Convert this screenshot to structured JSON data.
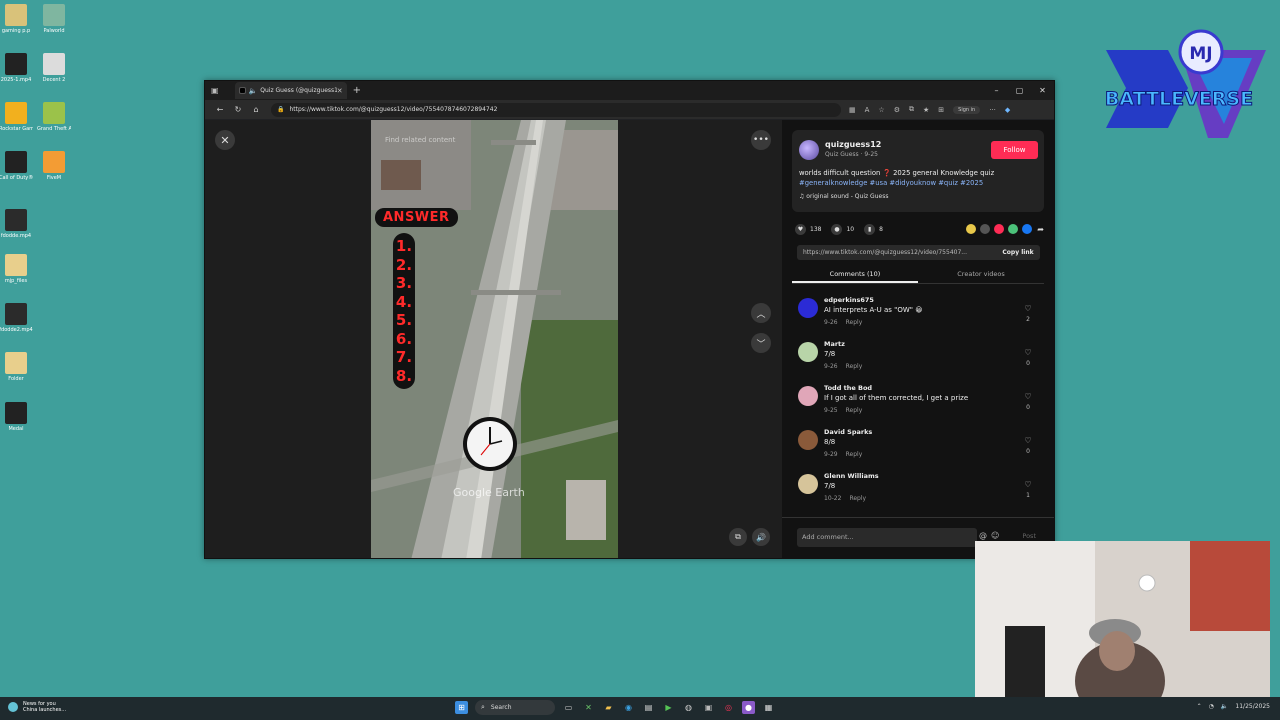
{
  "desktop": {
    "icons": [
      {
        "label": "gaming p.p",
        "color": "#d9c27a"
      },
      {
        "label": "Palworld",
        "color": "#7fb6a0"
      },
      {
        "label": "2025-1.mp4",
        "color": "#222222"
      },
      {
        "label": "Decent 2",
        "color": "#dcdcdc"
      },
      {
        "label": "Rockstar Games ...",
        "color": "#f2b01e"
      },
      {
        "label": "Grand Theft Auto V Le...",
        "color": "#9bc24a"
      },
      {
        "label": "Call of Duty®",
        "color": "#222222"
      },
      {
        "label": "FiveM",
        "color": "#f39c34"
      },
      {
        "label": "fdodde.mp4",
        "color": "#2b2b2b"
      },
      {
        "label": "mjp_files",
        "color": "#e8cf8c"
      },
      {
        "label": "fdodde2.mp4",
        "color": "#2b2b2b"
      },
      {
        "label": "Folder",
        "color": "#e8cf8c"
      },
      {
        "label": "Medal",
        "color": "#222222"
      }
    ]
  },
  "overlay_logo": {
    "text": "BATTLEVERSE",
    "monogram": "MJ",
    "badge": "DV"
  },
  "browser": {
    "tab_title": "Quiz Guess (@quizguess12)",
    "new_tab": "+",
    "url": "https://www.tiktok.com/@quizguess12/video/7554078746072894742",
    "sign_in": "Sign in",
    "window_controls": [
      "–",
      "▢",
      "✕"
    ]
  },
  "video": {
    "answer_label": "ANSWER",
    "numbers": [
      "1.",
      "2.",
      "3.",
      "4.",
      "5.",
      "6.",
      "7.",
      "8."
    ],
    "hint": "Find related content",
    "watermark": "Google Earth"
  },
  "creator": {
    "username": "quizguess12",
    "subline": "Quiz Guess · 9-25",
    "follow_label": "Follow",
    "description": "worlds difficult question ❓ 2025 general Knowledge quiz",
    "hashtags": "#generalknowledge #usa #didyouknow #quiz #2025",
    "sound": "♫  original sound - Quiz Guess"
  },
  "stats": {
    "likes": "138",
    "comments": "10",
    "saves": "8",
    "share_colors": [
      "#e8c84a",
      "#555555",
      "#fe2c55",
      "#4cc27a",
      "#1877f2"
    ]
  },
  "link": {
    "text": "https://www.tiktok.com/@quizguess12/video/755407...",
    "copy_label": "Copy link"
  },
  "panel_tabs": {
    "comments": "Comments (10)",
    "creator_videos": "Creator videos"
  },
  "comments": [
    {
      "user": "edperkins675",
      "text": "AI interprets A-U as \"OW\" 😀",
      "date": "9-26",
      "reply": "Reply",
      "likes": "2",
      "avatar": "#2b2bd6"
    },
    {
      "user": "Martz",
      "text": "7/8",
      "date": "9-26",
      "reply": "Reply",
      "likes": "0",
      "avatar": "#b8d4a8"
    },
    {
      "user": "Todd the Bod",
      "text": "If I got all of them corrected, I get a prize",
      "date": "9-25",
      "reply": "Reply",
      "likes": "0",
      "avatar": "#e0a6b8"
    },
    {
      "user": "David Sparks",
      "text": "8/8",
      "date": "9-29",
      "reply": "Reply",
      "likes": "0",
      "avatar": "#8a5a3a"
    },
    {
      "user": "Glenn Williams",
      "text": "7/8",
      "date": "10-22",
      "reply": "Reply",
      "likes": "1",
      "avatar": "#d6c49a"
    }
  ],
  "add_comment": {
    "placeholder": "Add comment...",
    "post_label": "Post"
  },
  "taskbar": {
    "news_line1": "News for you",
    "news_line2": "China launches...",
    "search_label": "Search",
    "date": "11/25/2025"
  }
}
